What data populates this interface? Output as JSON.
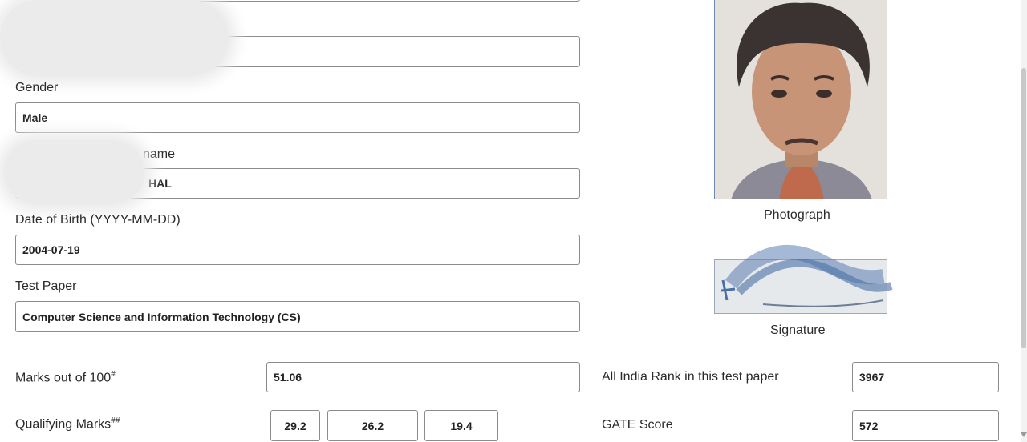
{
  "form": {
    "name_label": "",
    "name_value": "",
    "gender_label": "Gender",
    "gender_value": "Male",
    "parent_label_partial": "P",
    "parent_label_suffix": "name",
    "parent_value_partial": "HAL",
    "dob_label": "Date of Birth (YYYY-MM-DD)",
    "dob_value": "2004-07-19",
    "test_paper_label": "Test Paper",
    "test_paper_value": "Computer Science and Information Technology (CS)"
  },
  "media": {
    "photo_caption": "Photograph",
    "signature_caption": "Signature"
  },
  "results": {
    "marks_label": "Marks out of 100",
    "marks_sup": "#",
    "marks_value": "51.06",
    "qualifying_label": "Qualifying Marks",
    "qualifying_sup": "##",
    "qualifying_values": [
      "29.2",
      "26.2",
      "19.4"
    ],
    "rank_label": "All India Rank in this test paper",
    "rank_value": "3967",
    "score_label": "GATE Score",
    "score_value": "572"
  },
  "colors": {
    "border": "#8c8c8c",
    "photo_border": "#6f87a8",
    "signature_ink": "#4a6fa5"
  }
}
